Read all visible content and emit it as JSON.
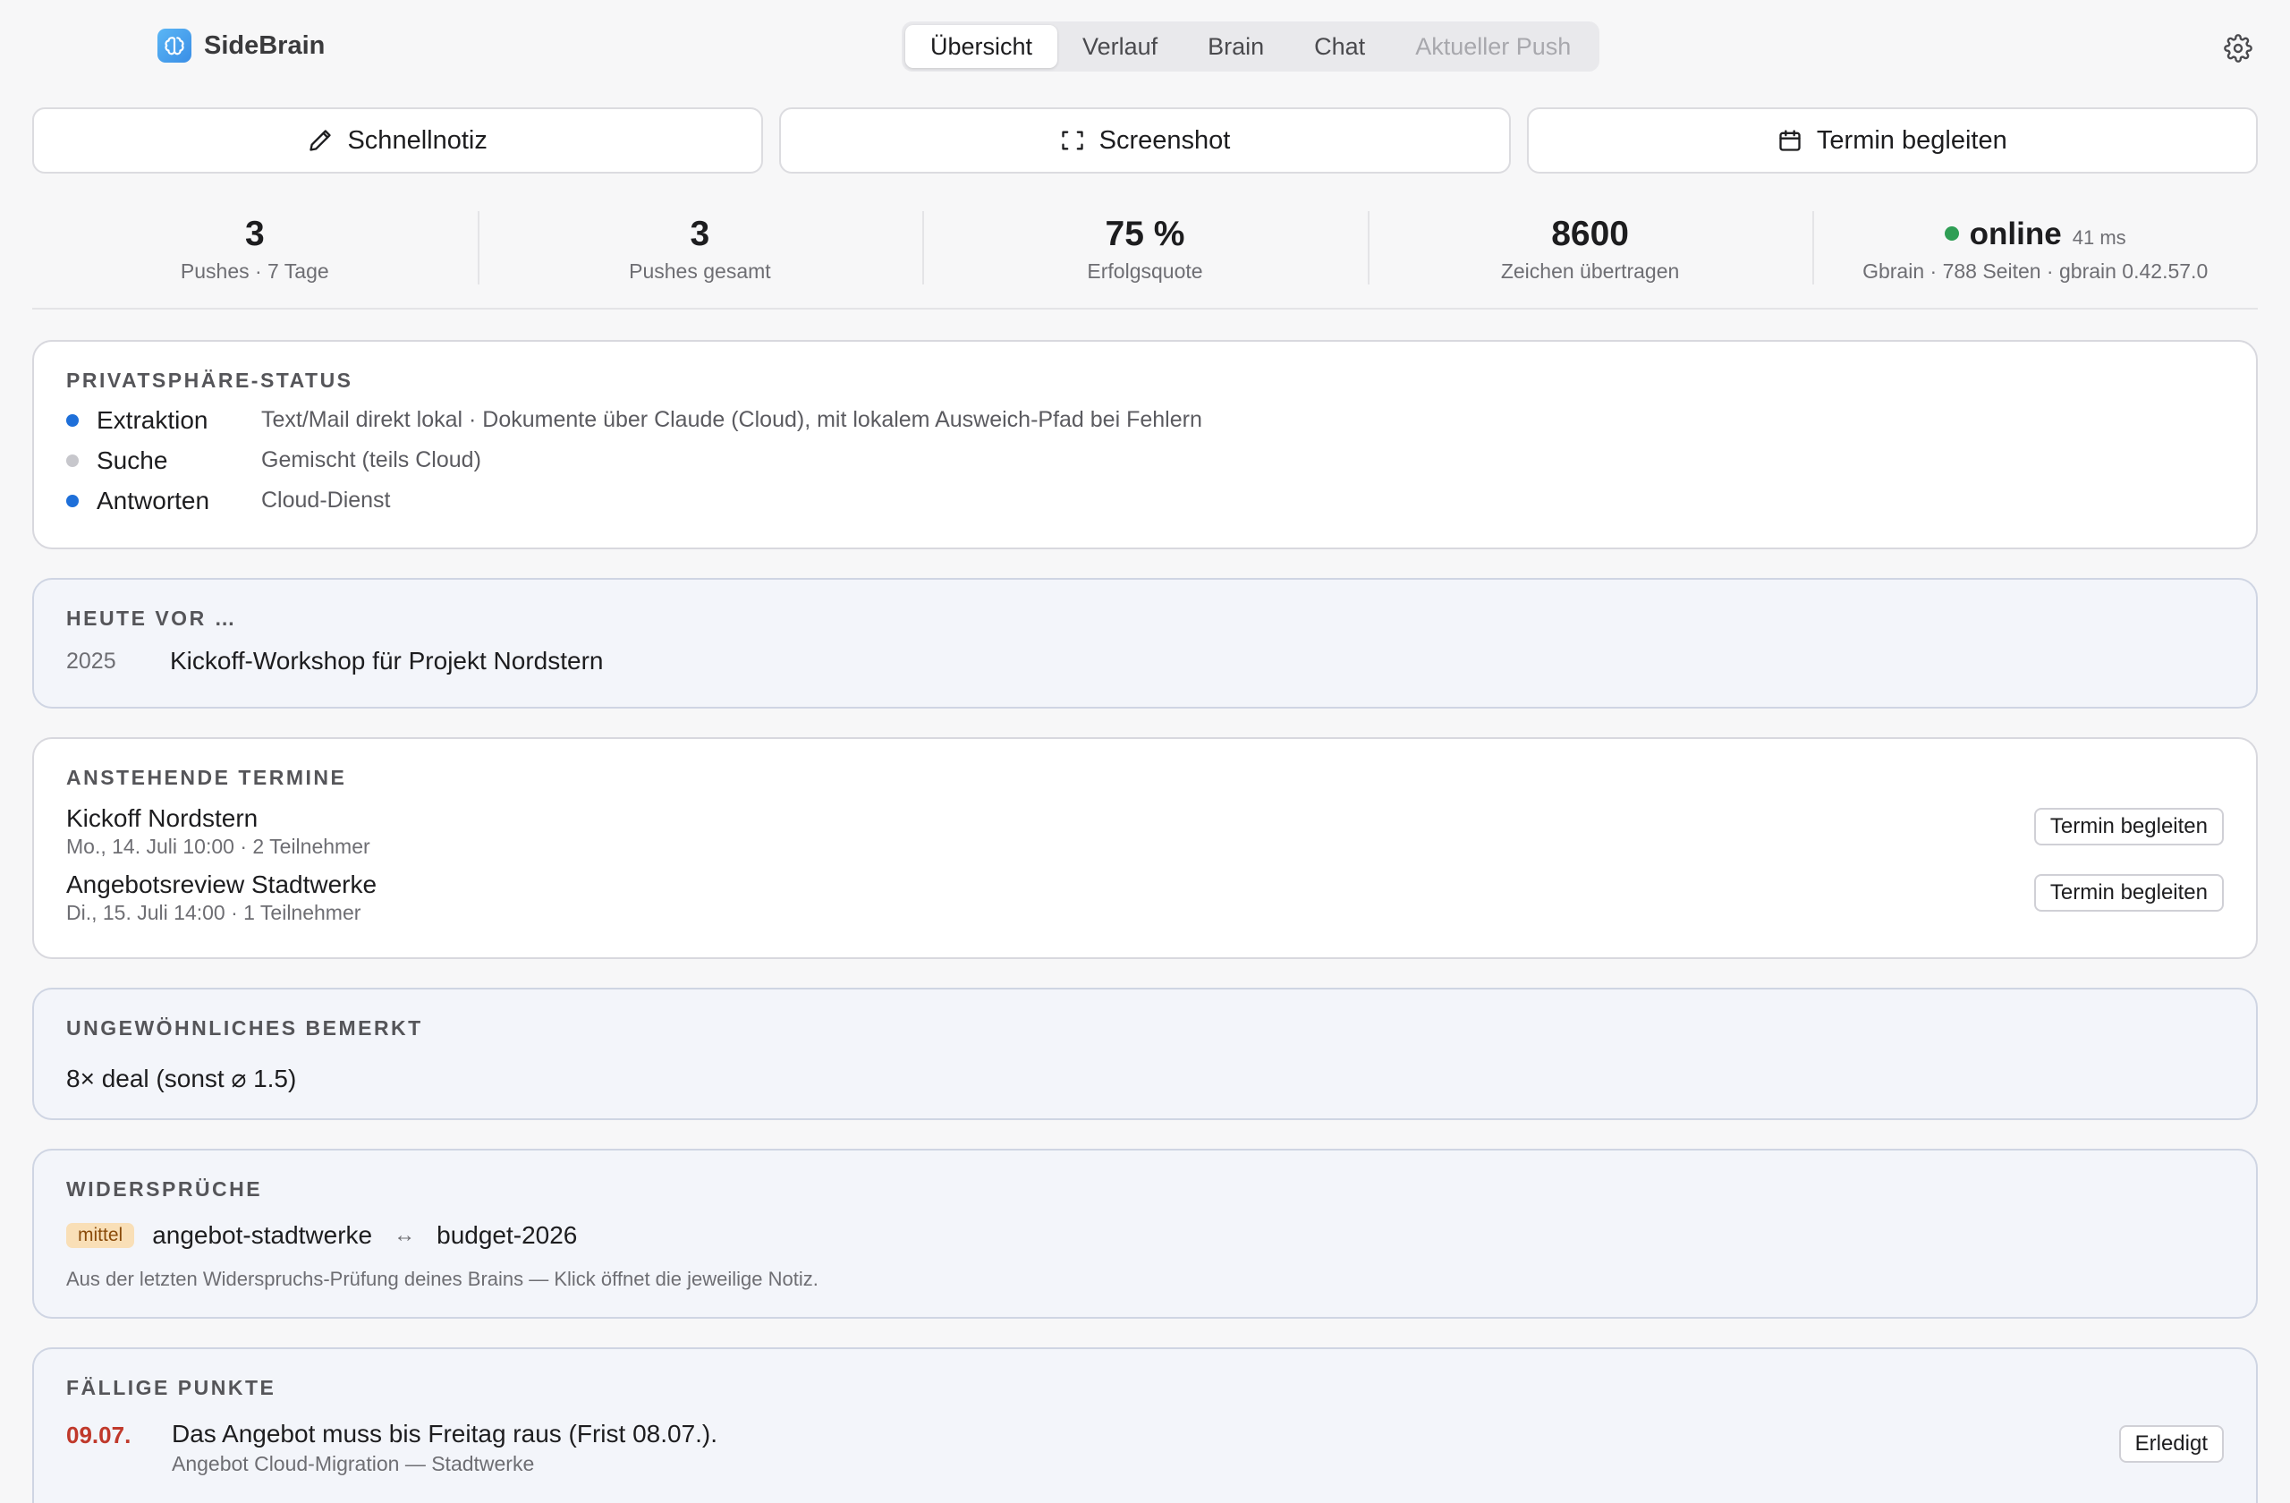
{
  "app": {
    "name": "SideBrain"
  },
  "tabs": [
    {
      "label": "Übersicht",
      "state": "active"
    },
    {
      "label": "Verlauf",
      "state": "normal"
    },
    {
      "label": "Brain",
      "state": "normal"
    },
    {
      "label": "Chat",
      "state": "normal"
    },
    {
      "label": "Aktueller Push",
      "state": "disabled"
    }
  ],
  "actions": {
    "note": "Schnellnotiz",
    "screenshot": "Screenshot",
    "meeting": "Termin begleiten"
  },
  "stats": {
    "pushes_week": {
      "value": "3",
      "label": "Pushes · 7 Tage"
    },
    "pushes_total": {
      "value": "3",
      "label": "Pushes gesamt"
    },
    "success": {
      "value": "75 %",
      "label": "Erfolgsquote"
    },
    "chars": {
      "value": "8600",
      "label": "Zeichen übertragen"
    },
    "status": {
      "value": "online",
      "latency": "41 ms",
      "label": "Gbrain · 788 Seiten · gbrain 0.42.57.0",
      "color": "#2f9e55"
    }
  },
  "privacy": {
    "title": "Privatsphäre-Status",
    "items": [
      {
        "name": "Extraktion",
        "desc": "Text/Mail direkt lokal · Dokumente über Claude (Cloud), mit lokalem Ausweich-Pfad bei Fehlern",
        "color": "#1e6fd9"
      },
      {
        "name": "Suche",
        "desc": "Gemischt (teils Cloud)",
        "color": "#c7c7cc"
      },
      {
        "name": "Antworten",
        "desc": "Cloud-Dienst",
        "color": "#1e6fd9"
      }
    ]
  },
  "history": {
    "title": "Heute vor …",
    "items": [
      {
        "year": "2025",
        "text": "Kickoff-Workshop für Projekt Nordstern"
      }
    ]
  },
  "appointments": {
    "title": "Anstehende Termine",
    "button_label": "Termin begleiten",
    "items": [
      {
        "title": "Kickoff Nordstern",
        "sub": "Mo., 14. Juli 10:00 · 2 Teilnehmer"
      },
      {
        "title": "Angebotsreview Stadtwerke",
        "sub": "Di., 15. Juli 14:00 · 1 Teilnehmer"
      }
    ]
  },
  "anomalies": {
    "title": "Ungewöhnliches bemerkt",
    "text": "8× deal (sonst ⌀ 1.5)"
  },
  "contradictions": {
    "title": "Widersprüche",
    "badge": "mittel",
    "left": "angebot-stadtwerke",
    "arrow": "↔",
    "right": "budget-2026",
    "note": "Aus der letzten Widerspruchs-Prüfung deines Brains — Klick öffnet die jeweilige Notiz."
  },
  "due": {
    "title": "Fällige Punkte",
    "button_label": "Erledigt",
    "items": [
      {
        "date": "09.07.",
        "text": "Das Angebot muss bis Freitag raus (Frist 08.07.).",
        "sub": "Angebot Cloud-Migration — Stadtwerke"
      }
    ]
  }
}
